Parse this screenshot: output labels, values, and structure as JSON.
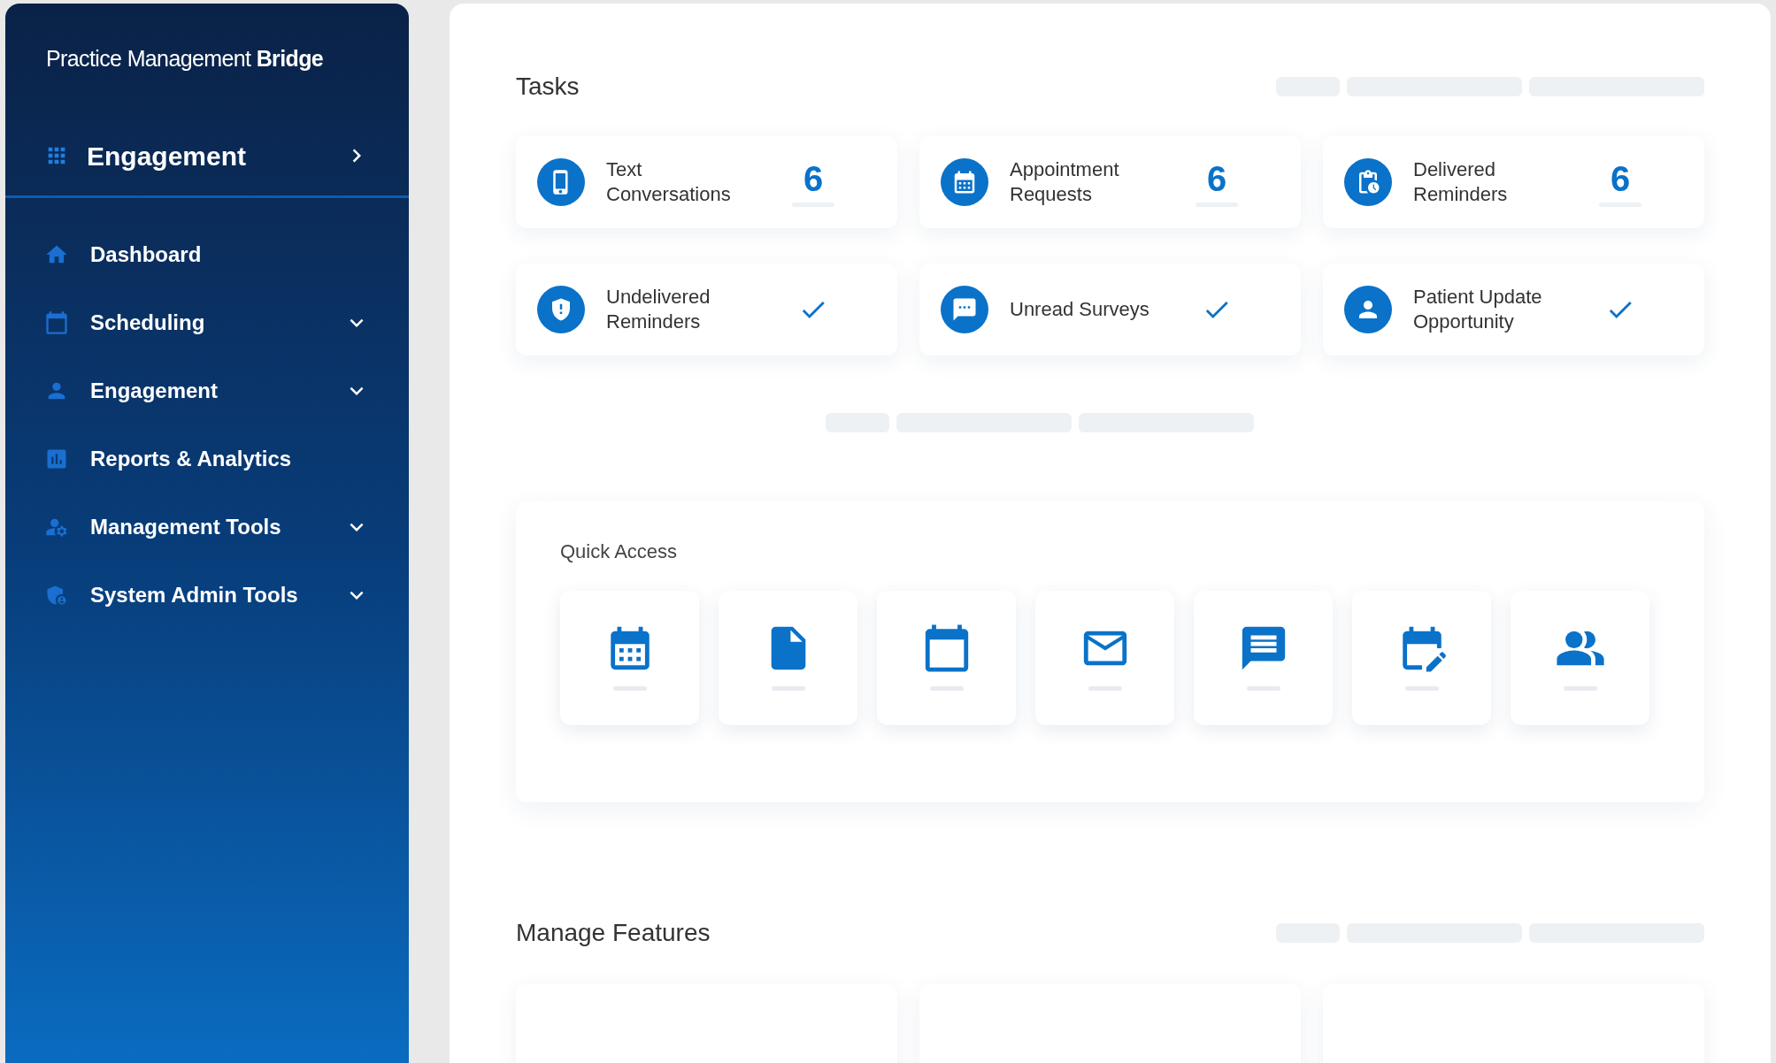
{
  "sidebar": {
    "brand": {
      "regular": "Practice Management",
      "bold": "Bridge"
    },
    "module": {
      "label": "Engagement"
    },
    "items": [
      {
        "label": "Dashboard",
        "has_submenu": false
      },
      {
        "label": "Scheduling",
        "has_submenu": true
      },
      {
        "label": "Engagement",
        "has_submenu": true
      },
      {
        "label": "Reports & Analytics",
        "has_submenu": false
      },
      {
        "label": "Management Tools",
        "has_submenu": true
      },
      {
        "label": "System Admin Tools",
        "has_submenu": true
      }
    ]
  },
  "tasks": {
    "title": "Tasks",
    "cards": [
      {
        "label": "Text Conversations",
        "kind": "count",
        "value": "6"
      },
      {
        "label": "Appointment Requests",
        "kind": "count",
        "value": "6"
      },
      {
        "label": "Delivered Reminders",
        "kind": "count",
        "value": "6"
      },
      {
        "label": "Undelivered Reminders",
        "kind": "check"
      },
      {
        "label": "Unread Surveys",
        "kind": "check"
      },
      {
        "label": "Patient Update Opportunity",
        "kind": "check"
      }
    ]
  },
  "quick_access": {
    "title": "Quick Access"
  },
  "manage_features": {
    "title": "Manage Features"
  }
}
